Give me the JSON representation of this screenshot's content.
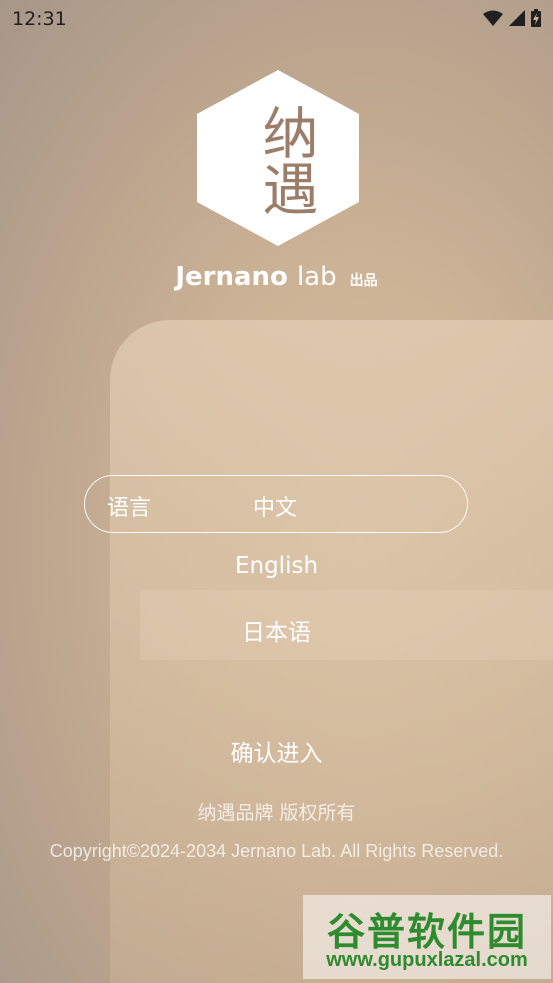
{
  "status_bar": {
    "time": "12:31",
    "icons": [
      "wifi-icon",
      "signal-icon",
      "battery-icon"
    ]
  },
  "logo": {
    "chars": "纳遇",
    "brand_name": "Jernano",
    "brand_suffix": "lab",
    "made_by": "出品"
  },
  "language": {
    "label": "语言",
    "selected": "中文",
    "options": [
      "English",
      "日本语"
    ]
  },
  "confirm_label": "确认进入",
  "footer": {
    "brand_rights": "纳遇品牌 版权所有",
    "copyright": "Copyright©2024-2034 Jernano Lab. All Rights Reserved."
  },
  "watermark": {
    "title": "谷普软件园",
    "url": "www.gupuxlazal.com"
  },
  "colors": {
    "logo_text": "#9c7d6a",
    "watermark": "#2e8b2e"
  }
}
